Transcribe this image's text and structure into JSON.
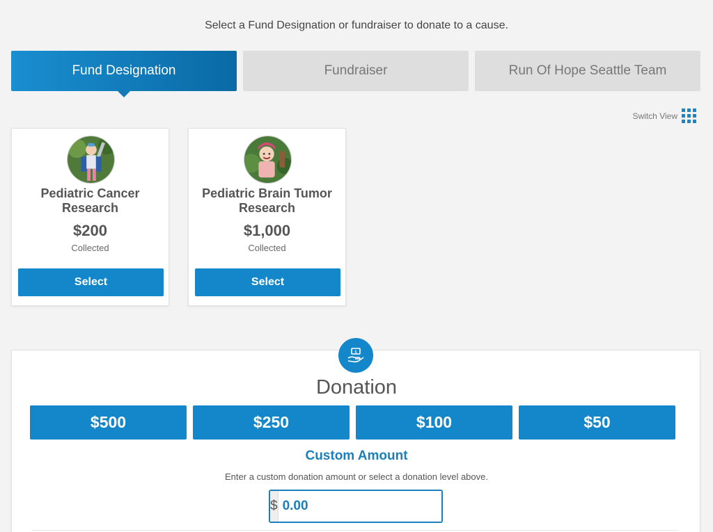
{
  "intro_text": "Select a Fund Designation or fundraiser to donate to a cause.",
  "tabs": [
    {
      "label": "Fund Designation",
      "active": true
    },
    {
      "label": "Fundraiser",
      "active": false
    },
    {
      "label": "Run Of Hope Seattle Team",
      "active": false
    }
  ],
  "switch_view": {
    "label": "Switch View",
    "icon": "grid-view-icon"
  },
  "cards": [
    {
      "title": "Pediatric Cancer Research",
      "amount": "$200",
      "collected_label": "Collected",
      "button_label": "Select"
    },
    {
      "title": "Pediatric Brain Tumor Research",
      "amount": "$1,000",
      "collected_label": "Collected",
      "button_label": "Select"
    }
  ],
  "donation": {
    "icon": "hand-money-icon",
    "title": "Donation",
    "levels": [
      "$500",
      "$250",
      "$100",
      "$50"
    ],
    "custom_title": "Custom Amount",
    "custom_help": "Enter a custom donation amount or select a donation level above.",
    "currency_symbol": "$",
    "amount_placeholder": "0.00"
  },
  "colors": {
    "primary": "#1387c9",
    "tab_inactive_bg": "#dedede",
    "accent_text": "#1a7fba"
  }
}
